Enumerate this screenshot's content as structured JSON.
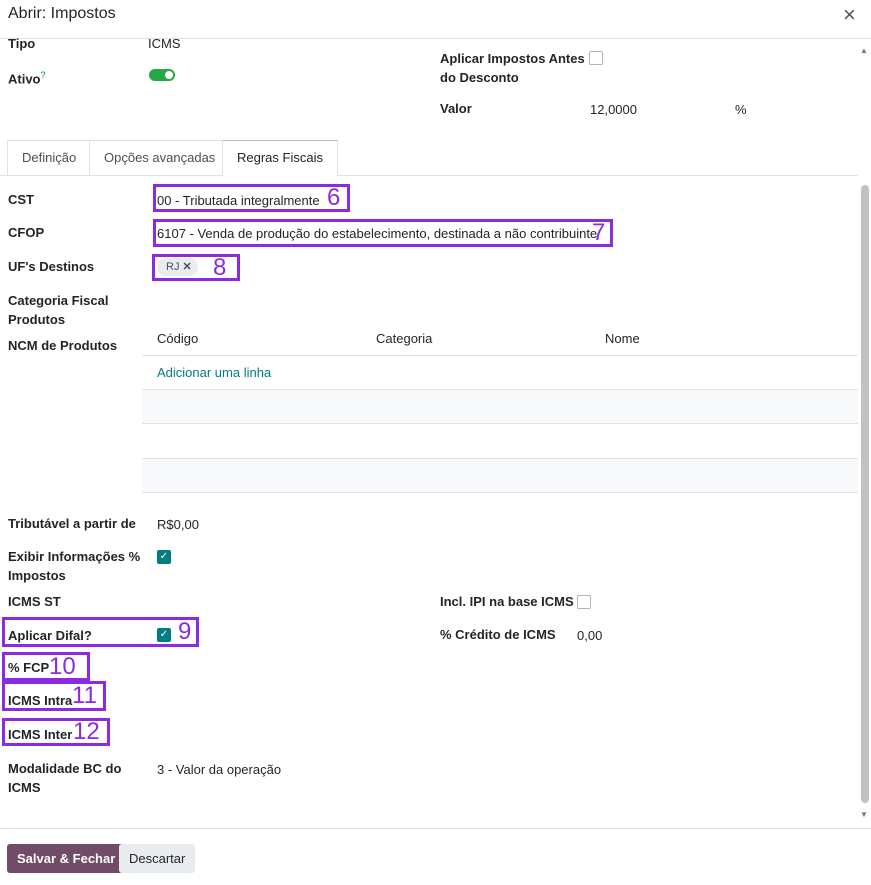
{
  "dialog": {
    "title": "Abrir: Impostos",
    "close_icon": "×"
  },
  "top": {
    "tipo_label": "Tipo",
    "tipo_value": "ICMS",
    "ativo_label": "Ativo",
    "ativo_help": "?",
    "aplicar_label_1": "Aplicar Impostos Antes",
    "aplicar_label_2": "do Desconto",
    "valor_label": "Valor",
    "valor_value": "12,0000",
    "valor_unit": "%"
  },
  "tabs": [
    {
      "label": "Definição"
    },
    {
      "label": "Opções avançadas"
    },
    {
      "label": "Regras Fiscais"
    }
  ],
  "fields": {
    "cst_label": "CST",
    "cst_value": "00 - Tributada integralmente",
    "cfop_label": "CFOP",
    "cfop_value": "6107 - Venda de produção do estabelecimento, destinada a não contribuinte",
    "uf_label": "UF's Destinos",
    "uf_tag": "RJ",
    "uf_tag_remove": "✕",
    "cat_label_1": "Categoria Fiscal",
    "cat_label_2": "Produtos",
    "ncm_label": "NCM de Produtos",
    "ncm_columns": [
      "Código",
      "Categoria",
      "Nome"
    ],
    "ncm_add": "Adicionar uma linha",
    "tributavel_label": "Tributável a partir de",
    "tributavel_value": "R$0,00",
    "exibir_label_1": "Exibir Informações %",
    "exibir_label_2": "Impostos",
    "icms_st_label": "ICMS ST",
    "incl_ipi_label": "Incl. IPI na base ICMS",
    "difal_label": "Aplicar Difal?",
    "credito_label": "% Crédito de ICMS",
    "credito_value": "0,00",
    "fcp_label": "% FCP",
    "icms_intra_label": "ICMS Intra",
    "icms_inter_label": "ICMS Inter",
    "modalidade_label_1": "Modalidade BC do",
    "modalidade_label_2": "ICMS",
    "modalidade_value": "3 - Valor da operação",
    "checkmark": "✓"
  },
  "annotations": [
    "6",
    "7",
    "8",
    "9",
    "10",
    "11",
    "12"
  ],
  "footer": {
    "save": "Salvar & Fechar",
    "discard": "Descartar"
  },
  "colors": {
    "accent": "#714b67",
    "teal": "#017e84",
    "annotation": "#8a2be2",
    "toggle": "#28a745"
  }
}
